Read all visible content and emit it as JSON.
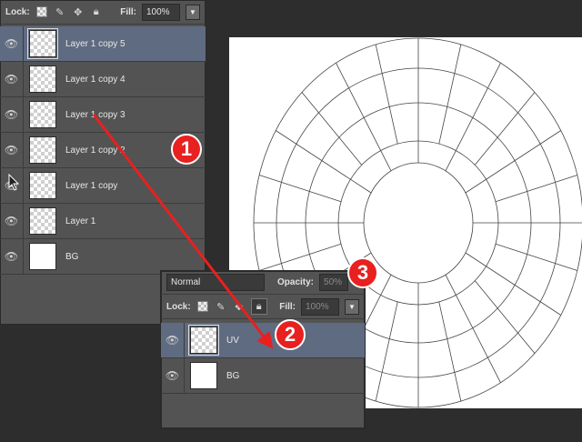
{
  "panel_main": {
    "lock_label": "Lock:",
    "fill_label": "Fill:",
    "fill_value": "100%",
    "layers": [
      {
        "name": "Layer 1 copy 5",
        "selected": true,
        "thumb": "transparent"
      },
      {
        "name": "Layer 1 copy 4",
        "selected": false,
        "thumb": "transparent"
      },
      {
        "name": "Layer 1 copy 3",
        "selected": false,
        "thumb": "transparent"
      },
      {
        "name": "Layer 1 copy 2",
        "selected": false,
        "thumb": "transparent"
      },
      {
        "name": "Layer 1 copy",
        "selected": false,
        "thumb": "transparent"
      },
      {
        "name": "Layer 1",
        "selected": false,
        "thumb": "transparent"
      },
      {
        "name": "BG",
        "selected": false,
        "thumb": "white"
      }
    ]
  },
  "panel_small": {
    "blend_mode": "Normal",
    "opacity_label": "Opacity:",
    "opacity_value": "50%",
    "lock_label": "Lock:",
    "fill_label": "Fill:",
    "fill_value": "100%",
    "layers": [
      {
        "name": "UV",
        "selected": true,
        "thumb": "transparent"
      },
      {
        "name": "BG",
        "selected": false,
        "thumb": "white"
      }
    ]
  },
  "badges": [
    "1",
    "2",
    "3"
  ],
  "colors": {
    "panel_bg": "#535353",
    "selected_row": "#5f6b80",
    "badge_red": "#e8201f",
    "arrow_red": "#e8201f"
  },
  "icons": [
    "eye-icon",
    "lock-transparent-icon",
    "lock-paint-icon",
    "lock-move-icon",
    "lock-all-icon",
    "dropdown-arrow-icon",
    "mouse-cursor-icon"
  ]
}
